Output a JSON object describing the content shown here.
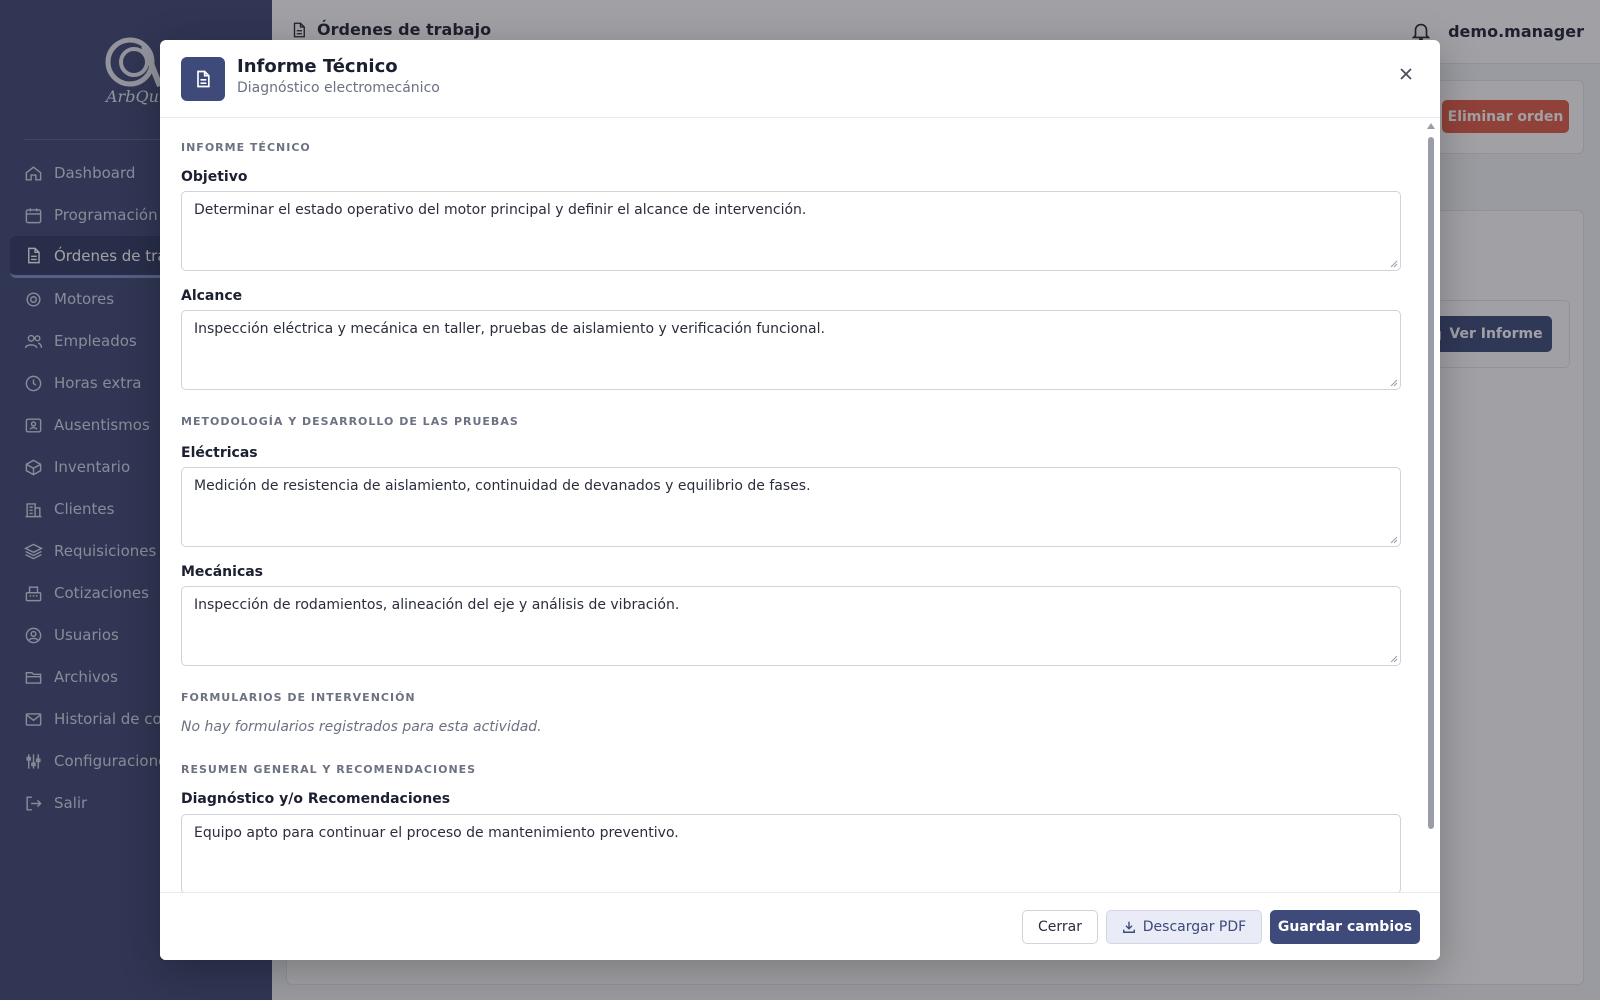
{
  "topbar": {
    "title": "Órdenes de trabajo",
    "user": "demo.manager"
  },
  "sidebar": {
    "logo_text": "ArbQuin",
    "items": [
      {
        "label": "Dashboard",
        "icon": "home-icon"
      },
      {
        "label": "Programación",
        "icon": "calendar-icon"
      },
      {
        "label": "Órdenes de trabajo",
        "icon": "document-icon",
        "active": true
      },
      {
        "label": "Motores",
        "icon": "cog-icon"
      },
      {
        "label": "Empleados",
        "icon": "users-icon"
      },
      {
        "label": "Horas extra",
        "icon": "clock-icon"
      },
      {
        "label": "Ausentismos",
        "icon": "badge-icon"
      },
      {
        "label": "Inventario",
        "icon": "box-icon"
      },
      {
        "label": "Clientes",
        "icon": "building-icon"
      },
      {
        "label": "Requisiciones",
        "icon": "layers-icon"
      },
      {
        "label": "Cotizaciones",
        "icon": "register-icon"
      },
      {
        "label": "Usuarios",
        "icon": "user-circle-icon"
      },
      {
        "label": "Archivos",
        "icon": "folder-icon"
      },
      {
        "label": "Historial de correos",
        "icon": "mail-icon"
      },
      {
        "label": "Configuraciones",
        "icon": "sliders-icon"
      },
      {
        "label": "Salir",
        "icon": "logout-icon"
      }
    ]
  },
  "background": {
    "delete_button": "Eliminar orden",
    "view_report_button": "Ver Informe"
  },
  "modal": {
    "title": "Informe Técnico",
    "subtitle": "Diagnóstico electromecánico",
    "sections": {
      "informe": "INFORME TÉCNICO",
      "metodologia": "METODOLOGÍA Y DESARROLLO DE LAS PRUEBAS",
      "formularios": "FORMULARIOS DE INTERVENCIÓN",
      "resumen": "RESUMEN GENERAL Y RECOMENDACIONES"
    },
    "fields": {
      "objetivo": {
        "label": "Objetivo",
        "value": "Determinar el estado operativo del motor principal y definir el alcance de intervención."
      },
      "alcance": {
        "label": "Alcance",
        "value": "Inspección eléctrica y mecánica en taller, pruebas de aislamiento y verificación funcional."
      },
      "electricas": {
        "label": "Eléctricas",
        "value": "Medición de resistencia de aislamiento, continuidad de devanados y equilibrio de fases."
      },
      "mecanicas": {
        "label": "Mecánicas",
        "value": "Inspección de rodamientos, alineación del eje y análisis de vibración."
      },
      "diagnostico": {
        "label": "Diagnóstico y/o Recomendaciones",
        "value": "Equipo apto para continuar el proceso de mantenimiento preventivo."
      }
    },
    "no_forms": "No hay formularios registrados para esta actividad.",
    "footer": {
      "close": "Cerrar",
      "download": "Descargar PDF",
      "save": "Guardar cambios"
    }
  },
  "colors": {
    "sidebar": "#3d4872",
    "primary": "#3d4a7a",
    "danger": "#e25a45"
  }
}
